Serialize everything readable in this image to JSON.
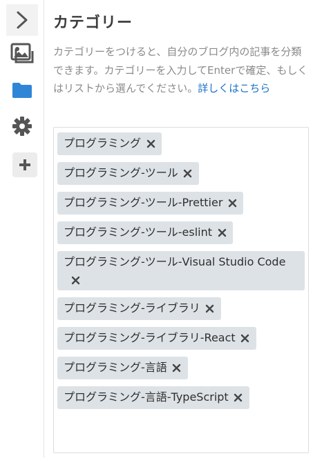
{
  "sidebar": {
    "icons": [
      "chevron-right-icon",
      "image-icon",
      "folder-icon",
      "gear-icon",
      "plus-icon"
    ],
    "colors": {
      "folder": "#2f86d6",
      "icon": "#555555"
    }
  },
  "category_panel": {
    "title": "カテゴリー",
    "description": "カテゴリーをつけると、自分のブログ内の記事を分類できます。カテゴリーを入力してEnterで確定、もしくはリストから選んでください。",
    "help_link": "詳しくはこちら",
    "tags": [
      {
        "label": "プログラミング"
      },
      {
        "label": "プログラミング-ツール"
      },
      {
        "label": "プログラミング-ツール-Prettier"
      },
      {
        "label": "プログラミング-ツール-eslint"
      },
      {
        "label": "プログラミング-ツール-Visual Studio Code"
      },
      {
        "label": "プログラミング-ライブラリ"
      },
      {
        "label": "プログラミング-ライブラリ-React"
      },
      {
        "label": "プログラミング-言語"
      },
      {
        "label": "プログラミング-言語-TypeScript"
      }
    ],
    "colors": {
      "tag_bg": "#dde2e6",
      "link": "#1a73c9"
    }
  }
}
